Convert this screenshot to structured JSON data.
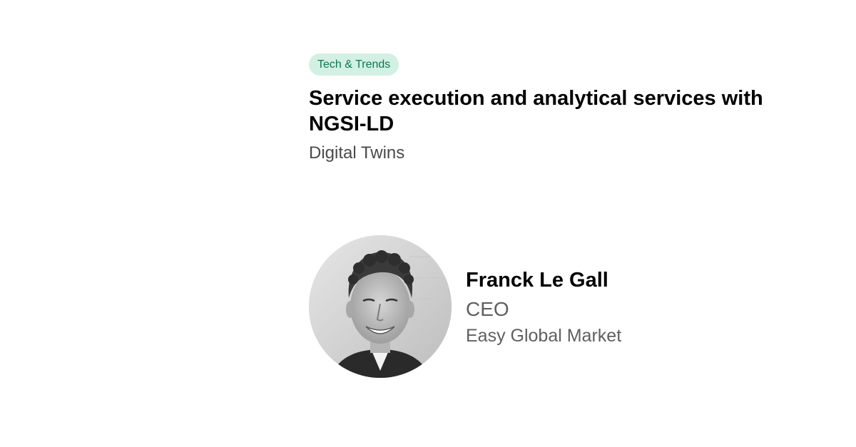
{
  "session": {
    "tag": "Tech & Trends",
    "title": "Service execution and analytical services with NGSI-LD",
    "subtitle": "Digital Twins"
  },
  "speaker": {
    "name": "Franck Le Gall",
    "role": "CEO",
    "company": "Easy Global Market",
    "photo_icon": "speaker-portrait-photo"
  },
  "colors": {
    "tag_bg": "#d2f0e3",
    "tag_text": "#0b7a4f",
    "title_text": "#000000",
    "muted_text": "#5f5f5f"
  }
}
